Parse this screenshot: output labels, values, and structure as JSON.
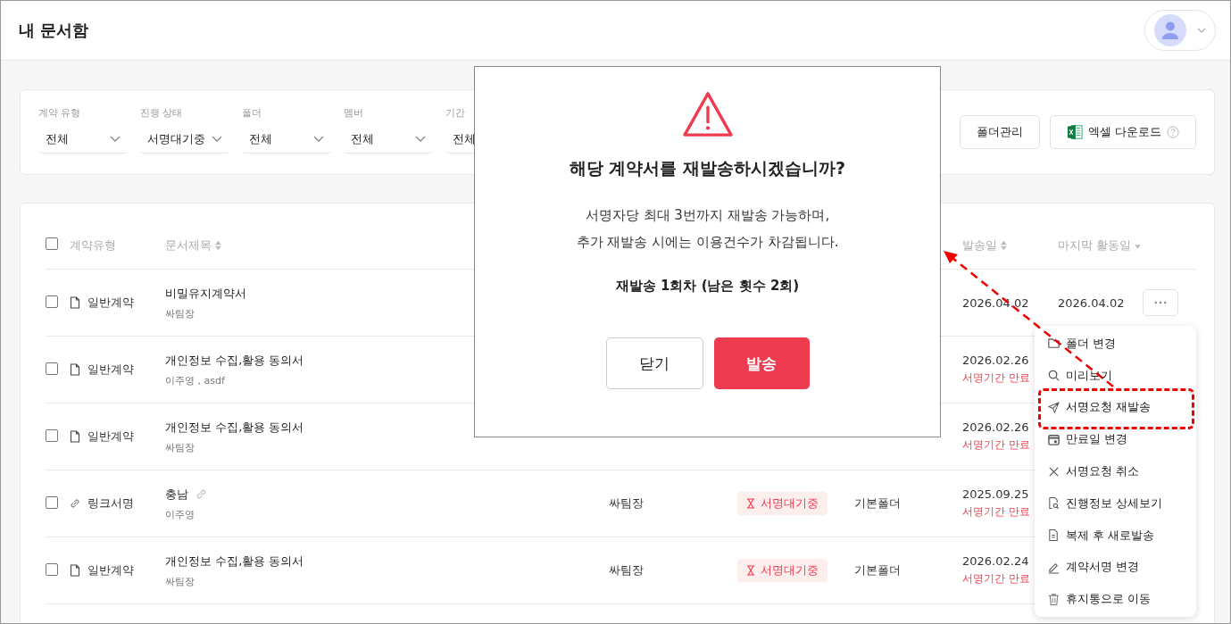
{
  "header": {
    "title": "내 문서함"
  },
  "filters": [
    {
      "label": "계약 유형",
      "value": "전체"
    },
    {
      "label": "진행 상태",
      "value": "서명대기중"
    },
    {
      "label": "폴더",
      "value": "전체"
    },
    {
      "label": "멤버",
      "value": "전체"
    },
    {
      "label": "기간",
      "value": "전체"
    }
  ],
  "actions": [
    {
      "label": "폴더관리",
      "kind": "plain"
    },
    {
      "label": "엑셀 다운로드",
      "kind": "excel"
    }
  ],
  "table": {
    "select_all_checked": false,
    "columns": [
      {
        "label": "계약유형"
      },
      {
        "label": "문서제목"
      },
      {
        "label": "발송일"
      },
      {
        "label": "마지막 활동일"
      }
    ],
    "rows": [
      {
        "checked": false,
        "kind": "document",
        "type": "일반계약",
        "title": "비밀유지계약서",
        "title_link": false,
        "signers": "싸팀장",
        "sent": "2026.04.02",
        "last_activity": "2026.04.02",
        "more": true
      },
      {
        "checked": false,
        "kind": "document",
        "type": "일반계약",
        "title": "개인정보 수집,활용 동의서",
        "title_link": false,
        "signers": "이주영 , asdf",
        "sent": "2026.02.26",
        "note": "서명기간 만료",
        "more": false
      },
      {
        "checked": false,
        "kind": "document",
        "type": "일반계약",
        "title": "개인정보 수집,활용 동의서",
        "title_link": false,
        "signers": "싸팀장",
        "sent": "2026.02.26",
        "note": "서명기간 만료",
        "more": false
      },
      {
        "checked": false,
        "kind": "link",
        "type": "링크서명",
        "title": "충남",
        "title_link": true,
        "signers": "이주영",
        "sender": "싸팀장",
        "status": "서명대기중",
        "folder": "기본폴더",
        "sent": "2025.09.25",
        "note": "서명기간 만료",
        "more": false
      },
      {
        "checked": false,
        "kind": "document",
        "type": "일반계약",
        "title": "개인정보 수집,활용 동의서",
        "title_link": false,
        "signers": "싸팀장",
        "sender": "싸팀장",
        "status": "서명대기중",
        "folder": "기본폴더",
        "sent": "2026.02.24",
        "note": "서명기간 만료",
        "more": false
      }
    ]
  },
  "modal": {
    "title": "해당 계약서를 재발송하시겠습니까?",
    "message": [
      "서명자당 최대 3번까지 재발송 가능하며,",
      "추가 재발송 시에는 이용건수가 차감됩니다."
    ],
    "count": "재발송 1회차 (남은 횟수 2회)",
    "buttons": [
      {
        "label": "닫기",
        "kind": "secondary"
      },
      {
        "label": "발송",
        "kind": "primary"
      }
    ]
  },
  "menu": [
    {
      "label": "폴더 변경",
      "highlighted": false
    },
    {
      "label": "미리보기",
      "highlighted": false
    },
    {
      "label": "서명요청 재발송",
      "highlighted": true
    },
    {
      "label": "만료일 변경",
      "highlighted": false
    },
    {
      "label": "서명요청 취소",
      "highlighted": false
    },
    {
      "label": "진행정보 상세보기",
      "highlighted": false
    },
    {
      "label": "복제 후 새로발송",
      "highlighted": false
    },
    {
      "label": "계약서명 변경",
      "highlighted": false
    },
    {
      "label": "휴지통으로 이동",
      "highlighted": false
    }
  ]
}
